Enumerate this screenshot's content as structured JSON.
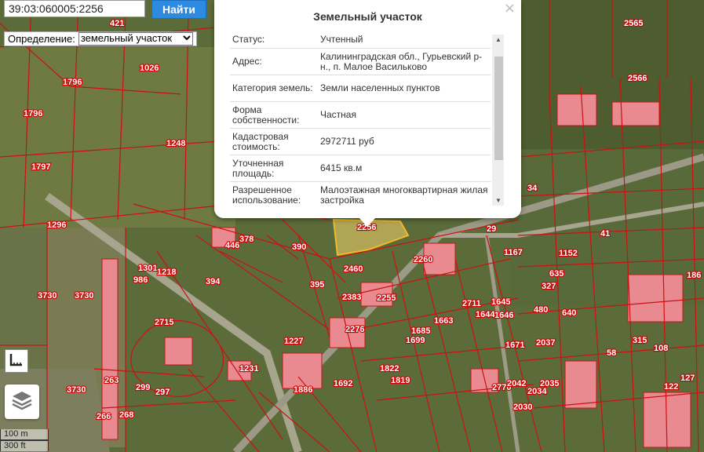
{
  "search": {
    "value": "39:03:060005:2256",
    "button": "Найти"
  },
  "definition": {
    "label": "Определение:",
    "selected": "земельный участок"
  },
  "popup": {
    "title": "Земельный участок",
    "close": "×",
    "rows": [
      {
        "key": "Статус:",
        "value": "Учтенный"
      },
      {
        "key": "Адрес:",
        "value": "Калининградская обл., Гурьевский р-н., п. Малое Васильково"
      },
      {
        "key": "Категория земель:",
        "value": "Земли населенных пунктов"
      },
      {
        "key": "Форма собственности:",
        "value": "Частная"
      },
      {
        "key": "Кадастровая стоимость:",
        "value": "2972711 руб"
      },
      {
        "key": "Уточненная площадь:",
        "value": "6415 кв.м"
      },
      {
        "key": "Разрешенное использование:",
        "value": "Малоэтажная многоквартирная жилая застройка"
      }
    ]
  },
  "scale": {
    "metric": "100 m",
    "imperial": "300 ft"
  },
  "map_labels": [
    "421",
    "1026",
    "1796",
    "1796",
    "1248",
    "1797",
    "1296",
    "2565",
    "2566",
    "3730",
    "3730",
    "3730",
    "2256",
    "2260",
    "2460",
    "2255",
    "2383",
    "2276",
    "378",
    "446",
    "390",
    "395",
    "394",
    "1301",
    "986",
    "1218",
    "2715",
    "1231",
    "1886",
    "263",
    "268",
    "266",
    "299",
    "297",
    "1692",
    "1663",
    "1685",
    "1699",
    "1822",
    "1819",
    "2037",
    "1671",
    "480",
    "640",
    "1152",
    "635",
    "327",
    "186",
    "58",
    "108",
    "315",
    "122",
    "127",
    "29",
    "1167",
    "34",
    "41",
    "2711",
    "1645",
    "1644",
    "1646",
    "2770",
    "2042",
    "2035",
    "2030",
    "2034",
    "1227"
  ],
  "colors": {
    "parcel_line": "#cc1111",
    "highlight": "#f5d36b",
    "button": "#2c8be0"
  },
  "icons": [
    "ruler-icon",
    "layers-icon",
    "close-icon",
    "chevron-down-icon"
  ]
}
